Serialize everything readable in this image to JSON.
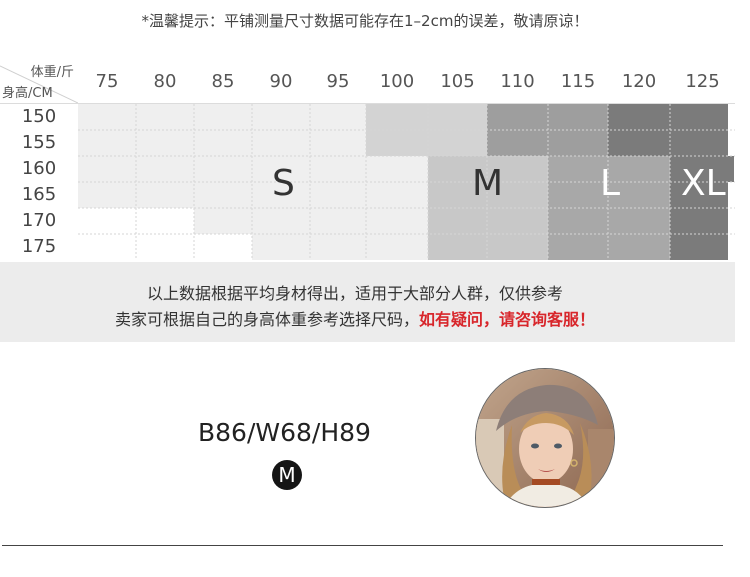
{
  "notice": "*温馨提示：平铺测量尺寸数据可能存在1–2cm的误差，敬请原谅！",
  "chart": {
    "weight_axis_label": "体重/斤",
    "height_axis_label": "身高/CM",
    "weights": [
      "75",
      "80",
      "85",
      "90",
      "95",
      "100",
      "105",
      "110",
      "115",
      "120",
      "125"
    ],
    "heights": [
      "150",
      "155",
      "160",
      "165",
      "170",
      "175"
    ],
    "sizes": {
      "s": "S",
      "m": "M",
      "l": "L",
      "xl": "XL"
    },
    "colors": {
      "s": "#efefef",
      "m_light": "#d3d3d3",
      "m_dark": "#c8c8c8",
      "l_light": "#9e9e9e",
      "l_dark": "#a8a8a8",
      "xl": "#7b7b7b"
    }
  },
  "note": {
    "line1": "以上数据根据平均身材得出，适用于大部分人群，仅供参考",
    "line2_plain": "卖家可根据自己的身高体重参考选择尺码，",
    "line2_highlight": "如有疑问，请咨询客服！"
  },
  "model": {
    "measurements": "B86/W68/H89",
    "size_badge": "M"
  }
}
